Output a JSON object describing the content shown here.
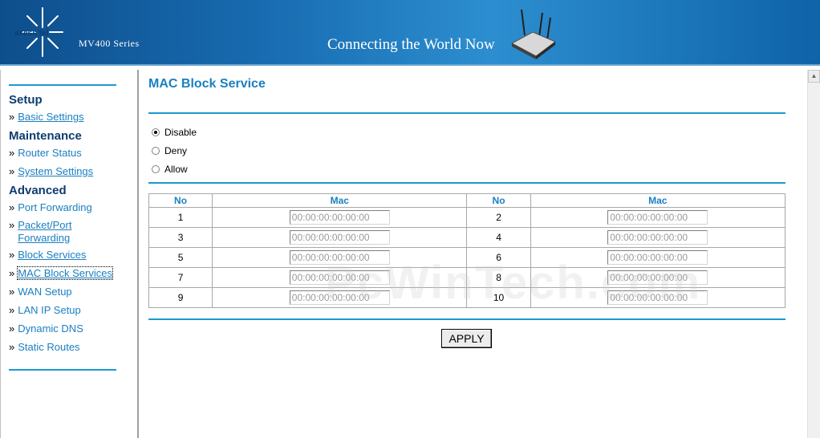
{
  "header": {
    "brand": "axess tel",
    "series": "MV400 Series",
    "slogan": "Connecting the World Now"
  },
  "sidebar": {
    "sections": [
      {
        "title": "Setup"
      },
      {
        "title": "Maintenance"
      },
      {
        "title": "Advanced"
      }
    ],
    "items": [
      {
        "label": "Basic Settings"
      },
      {
        "label": "Router Status"
      },
      {
        "label": "System Settings"
      },
      {
        "label": "Port Forwarding"
      },
      {
        "label": "Packet/Port"
      },
      {
        "label": "Forwarding"
      },
      {
        "label": "Block Services"
      },
      {
        "label": "MAC Block Services"
      },
      {
        "label": "WAN Setup"
      },
      {
        "label": "LAN IP Setup"
      },
      {
        "label": "Dynamic DNS"
      },
      {
        "label": "Static Routes"
      }
    ],
    "bullet": "»"
  },
  "main": {
    "title": "MAC Block Service",
    "mode_options": [
      {
        "label": "Disable",
        "checked": true
      },
      {
        "label": "Deny",
        "checked": false
      },
      {
        "label": "Allow",
        "checked": false
      }
    ],
    "table": {
      "headers": [
        "No",
        "Mac",
        "No",
        "Mac"
      ],
      "rows": [
        {
          "no_a": "1",
          "no_b": "2"
        },
        {
          "no_a": "3",
          "no_b": "4"
        },
        {
          "no_a": "5",
          "no_b": "6"
        },
        {
          "no_a": "7",
          "no_b": "8"
        },
        {
          "no_a": "9",
          "no_b": "10"
        }
      ],
      "mac_placeholder": "00:00:00:00:00:00"
    },
    "apply_label": "APPLY"
  },
  "watermark": "PcWinTech.com",
  "colors": {
    "accent": "#1a7fc0",
    "section": "#0d3d70",
    "rule": "#1a9ad0"
  }
}
